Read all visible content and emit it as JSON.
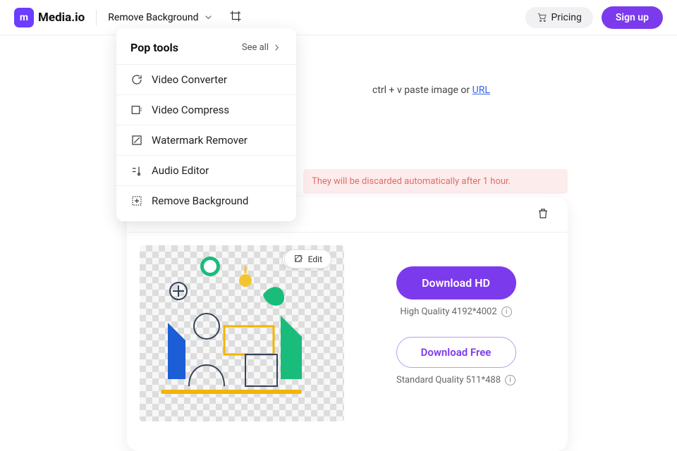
{
  "header": {
    "logo_text": "Media.io",
    "logo_letter": "m",
    "current_tool": "Remove Background",
    "pricing_label": "Pricing",
    "signup_label": "Sign up"
  },
  "dropdown": {
    "title": "Pop tools",
    "see_all": "See all",
    "items": [
      {
        "label": "Video Converter"
      },
      {
        "label": "Video Compress"
      },
      {
        "label": "Watermark Remover"
      },
      {
        "label": "Audio Editor"
      },
      {
        "label": "Remove Background"
      }
    ]
  },
  "paste_hint": {
    "prefix": "ctrl + v paste image or ",
    "url_label": "URL"
  },
  "warning": "They will be discarded automatically after 1 hour.",
  "result": {
    "edit_label": "Edit",
    "download_hd": "Download HD",
    "hd_meta": "High Quality 4192*4002",
    "download_free": "Download Free",
    "free_meta": "Standard Quality 511*488"
  }
}
